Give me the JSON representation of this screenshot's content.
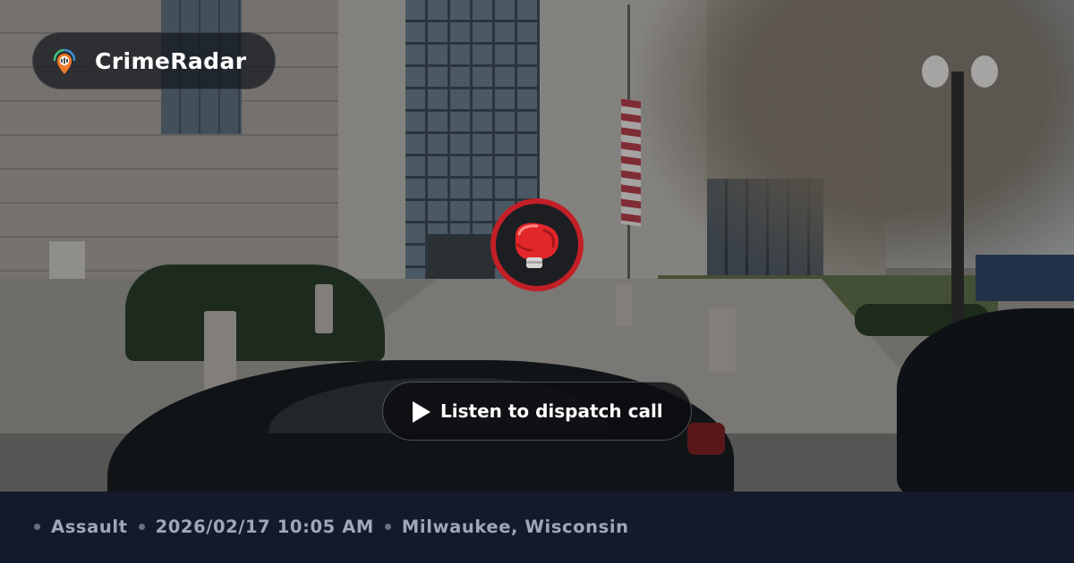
{
  "brand": {
    "name": "CrimeRadar",
    "logo_icon": "radar-pin-icon",
    "colors": {
      "ring_green": "#3fc27a",
      "ring_blue": "#3a8fd6",
      "pin_orange": "#f07a2b"
    }
  },
  "incident_badge": {
    "icon": "boxing-glove-icon",
    "ring_color": "#c21f26"
  },
  "dispatch": {
    "button_label": "Listen to dispatch call",
    "icon": "play-icon"
  },
  "info_bar": {
    "crime_type": "Assault",
    "datetime": "2026/02/17 10:05 AM",
    "location": "Milwaukee, Wisconsin",
    "background_color": "#141a2b",
    "text_color": "#a1a7b6"
  }
}
